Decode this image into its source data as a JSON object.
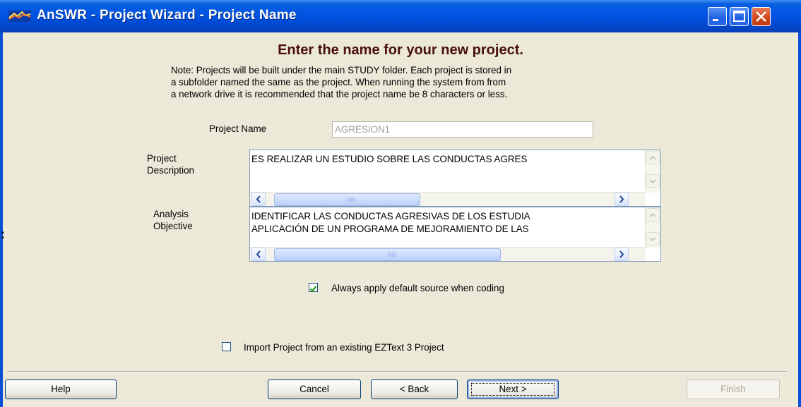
{
  "window": {
    "title": "AnSWR - Project Wizard - Project Name"
  },
  "wizard": {
    "heading": "Enter the name for your new project.",
    "note_lines": [
      "Note: Projects will be built under the main STUDY folder. Each project is stored in",
      "a subfolder named the same as the project. When running the system from from",
      "a network drive it is recommended that the project name be 8 characters or less."
    ],
    "project_name": {
      "label": "Project Name",
      "value": "AGRESION1"
    },
    "project_description": {
      "label_lines": [
        "Project",
        "Description"
      ],
      "value": "ES REALIZAR UN ESTUDIO SOBRE LAS CONDUCTAS AGRES",
      "hscroll_fraction": 0.42
    },
    "analysis_objective": {
      "label_lines": [
        "Analysis",
        "Objective"
      ],
      "lines": [
        "IDENTIFICAR LAS CONDUCTAS AGRESIVAS DE LOS ESTUDIA",
        "APLICACIÓN DE UN PROGRAMA DE MEJORAMIENTO DE LAS"
      ],
      "hscroll_fraction": 0.65
    },
    "default_source": {
      "label": "Always apply default source when coding",
      "checked": true
    },
    "import_project": {
      "label": "Import Project from an existing EZText 3 Project",
      "checked": false
    }
  },
  "buttons": {
    "help": "Help",
    "cancel": "Cancel",
    "back": "< Back",
    "next": "Next >",
    "finish": "Finish"
  },
  "stray_mark": ":"
}
